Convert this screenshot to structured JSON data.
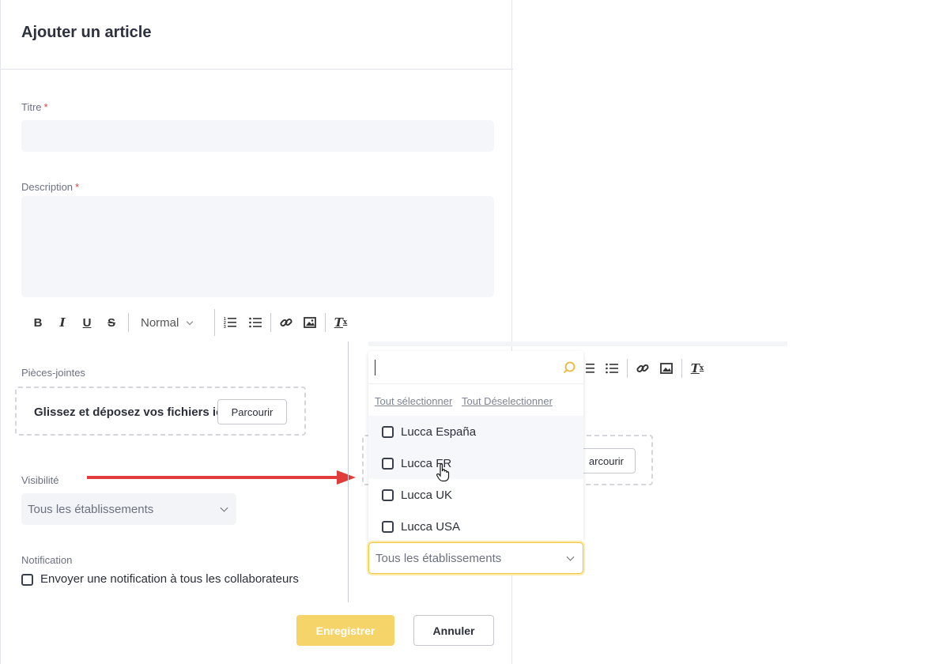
{
  "form": {
    "title": "Ajouter un article",
    "title_label": "Titre",
    "required_mark": "*",
    "description_label": "Description",
    "editor_format": "Normal",
    "attachments_label": "Pièces-jointes",
    "dropzone_text": "Glissez et déposez vos fichiers ici",
    "browse_label": "Parcourir",
    "visibility_label": "Visibilité",
    "visibility_value": "Tous les établissements",
    "notification_label": "Notification",
    "notification_checkbox_label": "Envoyer une notification à tous les collaborateurs",
    "save_label": "Enregistrer",
    "cancel_label": "Annuler"
  },
  "dropdown": {
    "search_value": "",
    "select_all": "Tout sélectionner",
    "deselect_all": "Tout Déselectionner",
    "options": [
      "Lucca España",
      "Lucca FR",
      "Lucca UK",
      "Lucca USA"
    ],
    "selected_value": "Tous les établissements",
    "background_browse_label": "arcourir"
  },
  "colors": {
    "accent": "#f5d46a",
    "arrow": "#e03d3a",
    "link": "#7e8492"
  }
}
